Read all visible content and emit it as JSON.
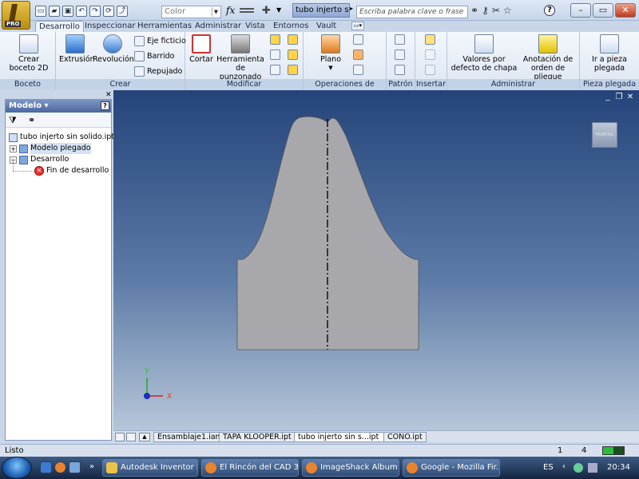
{
  "titlebar": {
    "color_combo": "Color",
    "document_title": "tubo injerto  sin solido.ipt",
    "search_placeholder": "Escriba palabra clave o frase",
    "fx": "fx",
    "help": "?"
  },
  "tabs": [
    "Desarrollo",
    "Inspeccionar",
    "Herramientas",
    "Administrar",
    "Vista",
    "Entornos",
    "Vault"
  ],
  "ribbon": {
    "groups": {
      "boceto": {
        "label": "Boceto",
        "crear_boceto": "Crear boceto 2D"
      },
      "crear": {
        "label": "Crear",
        "extrusion": "Extrusión",
        "revolucion": "Revolución",
        "eje": "Eje ficticio",
        "barrido": "Barrido",
        "repujado": "Repujado"
      },
      "modificar": {
        "label": "Modificar",
        "cortar": "Cortar",
        "herramienta": "Herramienta de punzonado"
      },
      "operaciones": {
        "label": "Operaciones de trabajo",
        "plano": "Plano"
      },
      "patron": {
        "label": "Patrón"
      },
      "insertar": {
        "label": "Insertar"
      },
      "administrar": {
        "label": "Administrar",
        "valores": "Valores por defecto de chapa",
        "anotacion": "Anotación de orden de pliegue"
      },
      "pieza": {
        "label": "Pieza plegada",
        "ir": "Ir a pieza plegada"
      }
    }
  },
  "browser": {
    "title": "Modelo ▾",
    "help": "?",
    "tree": [
      {
        "label": "tubo injerto  sin solido.ipt"
      },
      {
        "label": "Modelo plegado"
      },
      {
        "label": "Desarrollo"
      },
      {
        "label": "Fin de desarrollo"
      }
    ]
  },
  "viewcube_label": "FRONTAL",
  "triad": {
    "x": "X",
    "y": "Y"
  },
  "doc_tabs": [
    "Ensamblaje1.iam",
    "TAPA KLOOPER.ipt",
    "tubo injerto  sin s...ipt",
    "CONO.ipt"
  ],
  "status": {
    "text": "Listo",
    "count1": "1",
    "count2": "4"
  },
  "taskbar": {
    "items": [
      "Autodesk Inventor P...",
      "El Rincón del CAD 3...",
      "ImageShack Album ...",
      "Google - Mozilla Fir..."
    ],
    "lang": "ES",
    "clock": "20:34"
  },
  "colors": {
    "viewport_top": "#25447a",
    "viewport_bottom": "#b7c6d8",
    "part_fill": "#a8a8ac",
    "accent": "#4a679f"
  }
}
